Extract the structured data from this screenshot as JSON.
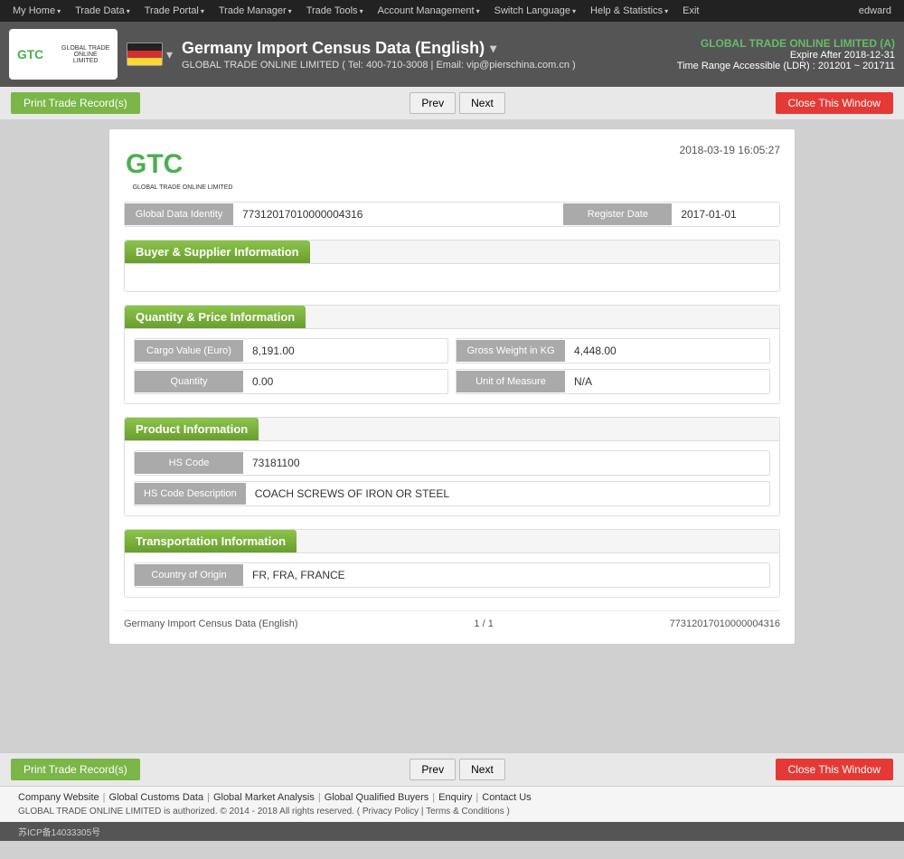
{
  "topnav": {
    "items": [
      {
        "label": "My Home",
        "arrow": "▾"
      },
      {
        "label": "Trade Data",
        "arrow": "▾"
      },
      {
        "label": "Trade Portal",
        "arrow": "▾"
      },
      {
        "label": "Trade Manager",
        "arrow": "▾"
      },
      {
        "label": "Trade Tools",
        "arrow": "▾"
      },
      {
        "label": "Account Management",
        "arrow": "▾"
      },
      {
        "label": "Switch Language",
        "arrow": "▾"
      },
      {
        "label": "Help & Statistics",
        "arrow": "▾"
      },
      {
        "label": "Exit"
      }
    ],
    "user": "edward"
  },
  "header": {
    "logo_text": "GTC",
    "logo_sub": "GLOBAL TRADE ONLINE LIMITED",
    "flag_alt": "Germany flag",
    "title": "Germany Import Census Data (English)",
    "title_arrow": "▾",
    "subtitle": "GLOBAL TRADE ONLINE LIMITED ( Tel: 400-710-3008 | Email: vip@pierschina.com.cn )",
    "company_name": "GLOBAL TRADE ONLINE LIMITED (A)",
    "expire": "Expire After 2018-12-31",
    "time_range": "Time Range Accessible (LDR) : 201201 ~ 201711"
  },
  "toolbar_top": {
    "print_label": "Print Trade Record(s)",
    "prev_label": "Prev",
    "next_label": "Next",
    "close_label": "Close This Window"
  },
  "record": {
    "timestamp": "2018-03-19 16:05:27",
    "logo_text": "GTC",
    "logo_sub": "GLOBAL TRADE ONLINE LIMITED",
    "identity": {
      "label_id": "Global Data Identity",
      "value_id": "77312017010000004316",
      "label_date": "Register Date",
      "value_date": "2017-01-01"
    },
    "buyer_supplier": {
      "title": "Buyer & Supplier Information"
    },
    "quantity_price": {
      "title": "Quantity & Price Information",
      "label_cargo": "Cargo Value (Euro)",
      "value_cargo": "8,191.00",
      "label_gross": "Gross Weight in KG",
      "value_gross": "4,448.00",
      "label_qty": "Quantity",
      "value_qty": "0.00",
      "label_unit": "Unit of Measure",
      "value_unit": "N/A"
    },
    "product": {
      "title": "Product Information",
      "label_hs": "HS Code",
      "value_hs": "73181100",
      "label_desc": "HS Code Description",
      "value_desc": "COACH SCREWS OF IRON OR STEEL"
    },
    "transportation": {
      "title": "Transportation Information",
      "label_origin": "Country of Origin",
      "value_origin": "FR, FRA, FRANCE"
    },
    "footer": {
      "title": "Germany Import Census Data (English)",
      "page": "1 / 1",
      "id": "77312017010000004316"
    }
  },
  "toolbar_bottom": {
    "print_label": "Print Trade Record(s)",
    "prev_label": "Prev",
    "next_label": "Next",
    "close_label": "Close This Window"
  },
  "footer": {
    "icp": "苏ICP备14033305号",
    "links": [
      "Company Website",
      "Global Customs Data",
      "Global Market Analysis",
      "Global Qualified Buyers",
      "Enquiry",
      "Contact Us"
    ],
    "copyright": "GLOBAL TRADE ONLINE LIMITED is authorized. © 2014 - 2018 All rights reserved.  (  Privacy Policy  |  Terms & Conditions  )"
  }
}
